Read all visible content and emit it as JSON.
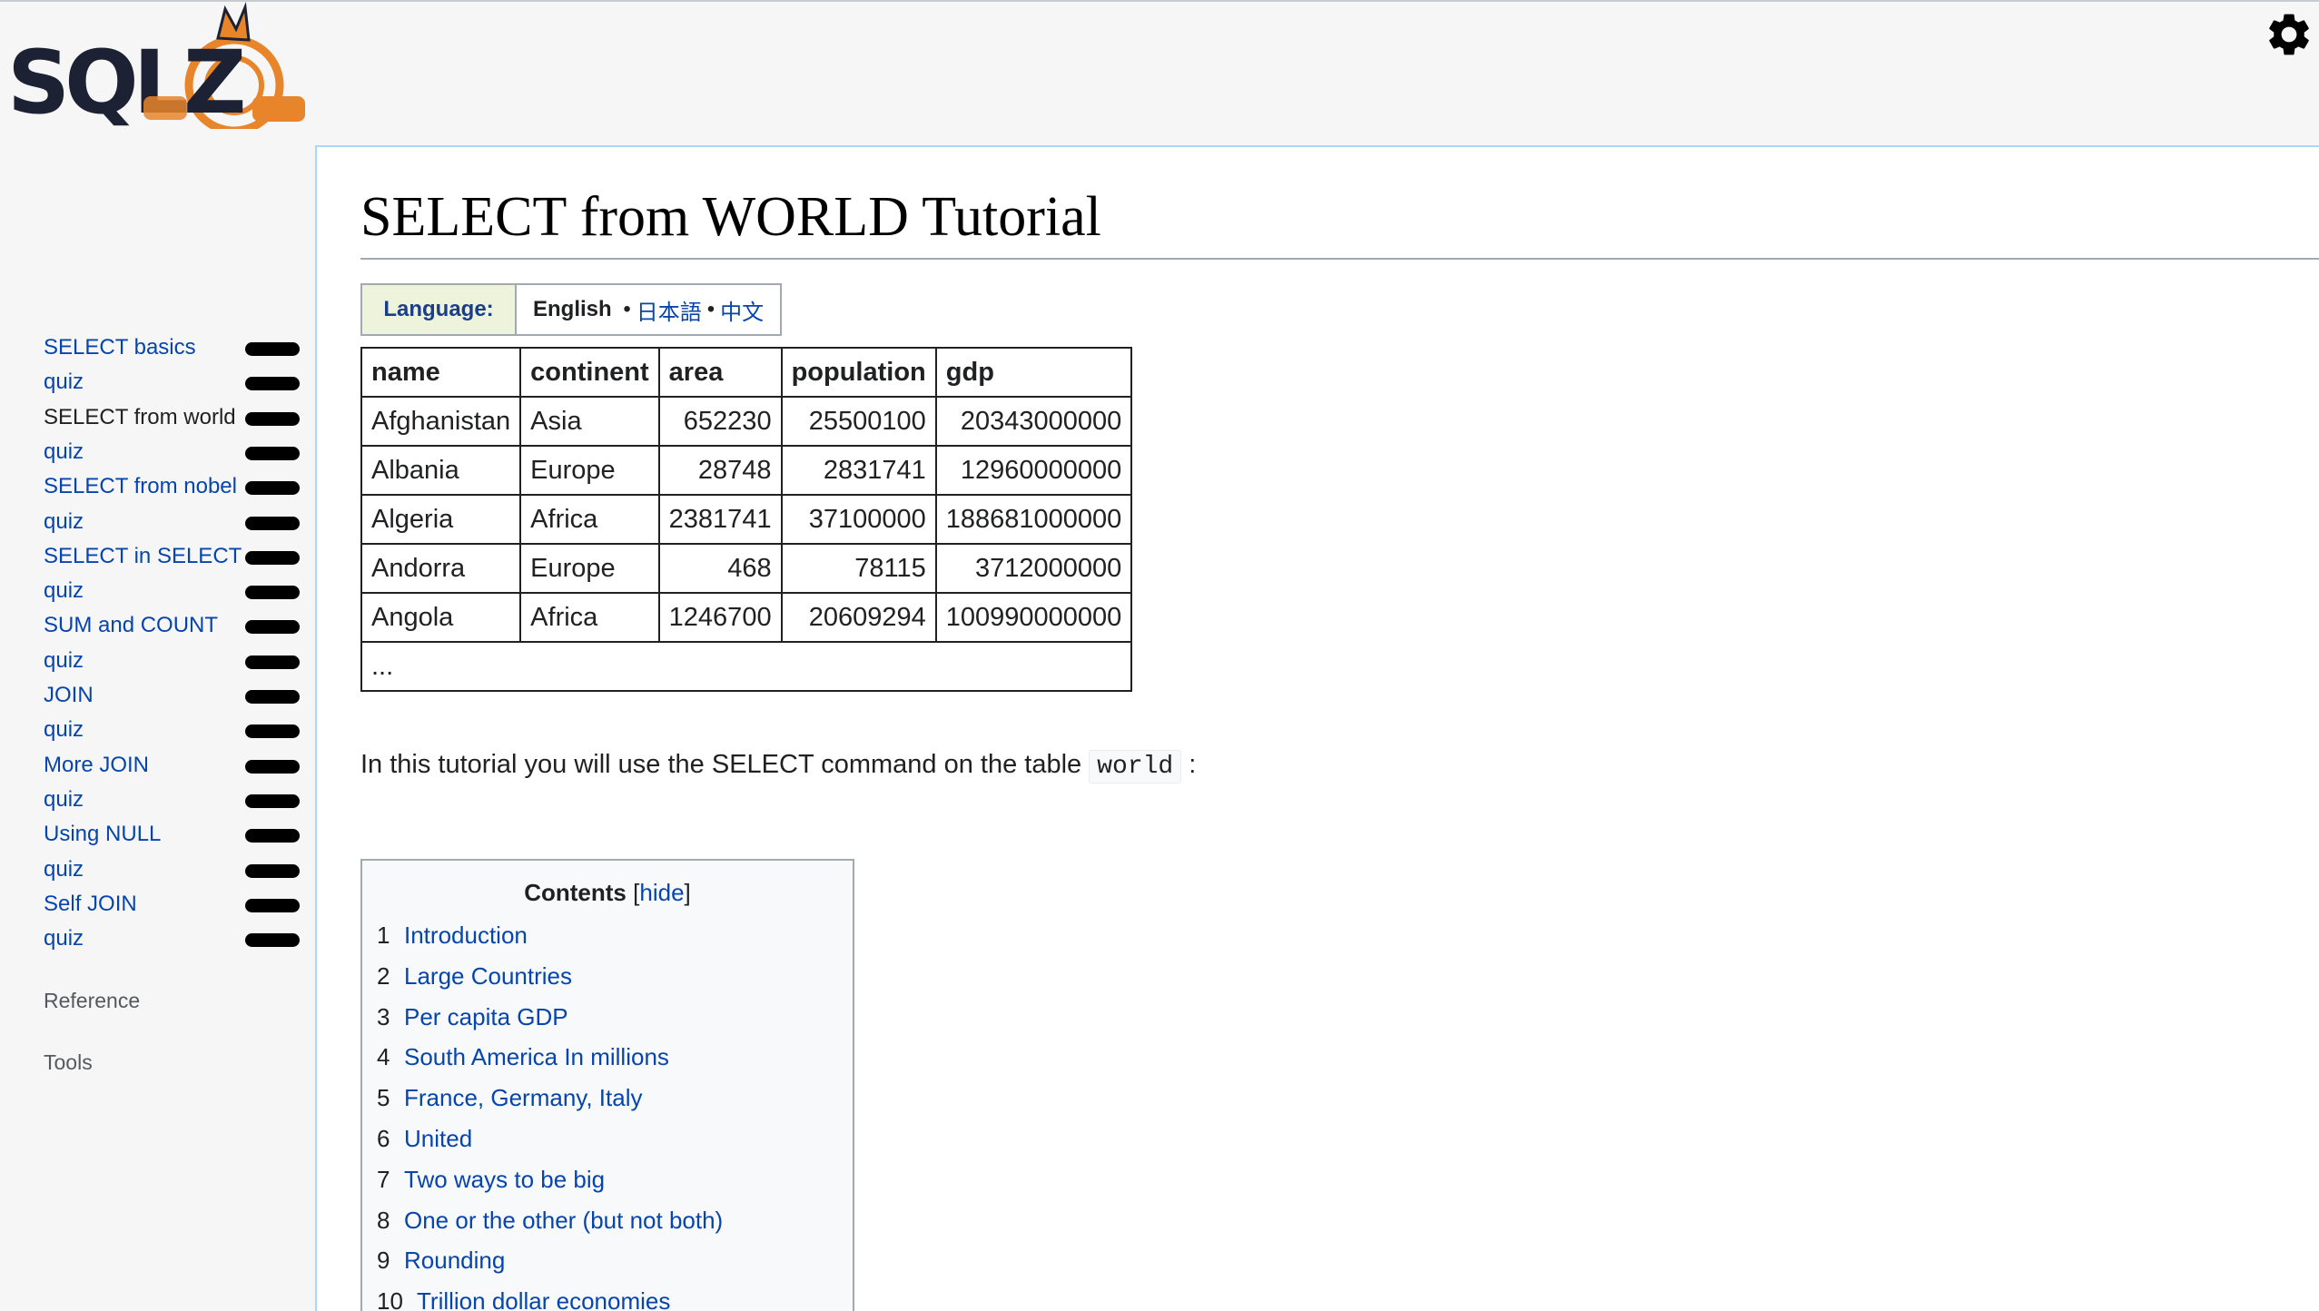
{
  "site": {
    "logo_text": "SQLZOO"
  },
  "sidebar": {
    "items": [
      {
        "label": "SELECT basics",
        "current": false
      },
      {
        "label": "quiz",
        "current": false
      },
      {
        "label": "SELECT from world",
        "current": true
      },
      {
        "label": "quiz",
        "current": false
      },
      {
        "label": "SELECT from nobel",
        "current": false
      },
      {
        "label": "quiz",
        "current": false
      },
      {
        "label": "SELECT in SELECT",
        "current": false
      },
      {
        "label": "quiz",
        "current": false
      },
      {
        "label": "SUM and COUNT",
        "current": false
      },
      {
        "label": "quiz",
        "current": false
      },
      {
        "label": "JOIN",
        "current": false
      },
      {
        "label": "quiz",
        "current": false
      },
      {
        "label": "More JOIN",
        "current": false
      },
      {
        "label": "quiz",
        "current": false
      },
      {
        "label": "Using NULL",
        "current": false
      },
      {
        "label": "quiz",
        "current": false
      },
      {
        "label": "Self JOIN",
        "current": false
      },
      {
        "label": "quiz",
        "current": false
      }
    ],
    "reference": "Reference",
    "tools": "Tools"
  },
  "page": {
    "title": "SELECT from WORLD Tutorial",
    "language": {
      "label": "Language:",
      "current": "English",
      "others": [
        "日本語",
        "中文"
      ]
    },
    "table": {
      "headers": [
        "name",
        "continent",
        "area",
        "population",
        "gdp"
      ],
      "rows": [
        [
          "Afghanistan",
          "Asia",
          "652230",
          "25500100",
          "20343000000"
        ],
        [
          "Albania",
          "Europe",
          "28748",
          "2831741",
          "12960000000"
        ],
        [
          "Algeria",
          "Africa",
          "2381741",
          "37100000",
          "188681000000"
        ],
        [
          "Andorra",
          "Europe",
          "468",
          "78115",
          "3712000000"
        ],
        [
          "Angola",
          "Africa",
          "1246700",
          "20609294",
          "100990000000"
        ]
      ],
      "ellipsis": "..."
    },
    "intro_before": "In this tutorial you will use the SELECT command on the table ",
    "intro_code": "world",
    "intro_after": " :",
    "toc": {
      "title": "Contents",
      "hide_label": "hide",
      "items": [
        {
          "num": "1",
          "label": "Introduction"
        },
        {
          "num": "2",
          "label": "Large Countries"
        },
        {
          "num": "3",
          "label": "Per capita GDP"
        },
        {
          "num": "4",
          "label": "South America In millions"
        },
        {
          "num": "5",
          "label": "France, Germany, Italy"
        },
        {
          "num": "6",
          "label": "United"
        },
        {
          "num": "7",
          "label": "Two ways to be big"
        },
        {
          "num": "8",
          "label": "One or the other (but not both)"
        },
        {
          "num": "9",
          "label": "Rounding"
        },
        {
          "num": "10",
          "label": "Trillion dollar economies"
        }
      ]
    }
  },
  "colors": {
    "link": "#0645ad",
    "text": "#202122",
    "sidebar_bg": "#f6f6f6",
    "border_accent": "#a7d7f9",
    "logo_navy": "#1c2233",
    "logo_orange": "#e8852b"
  }
}
